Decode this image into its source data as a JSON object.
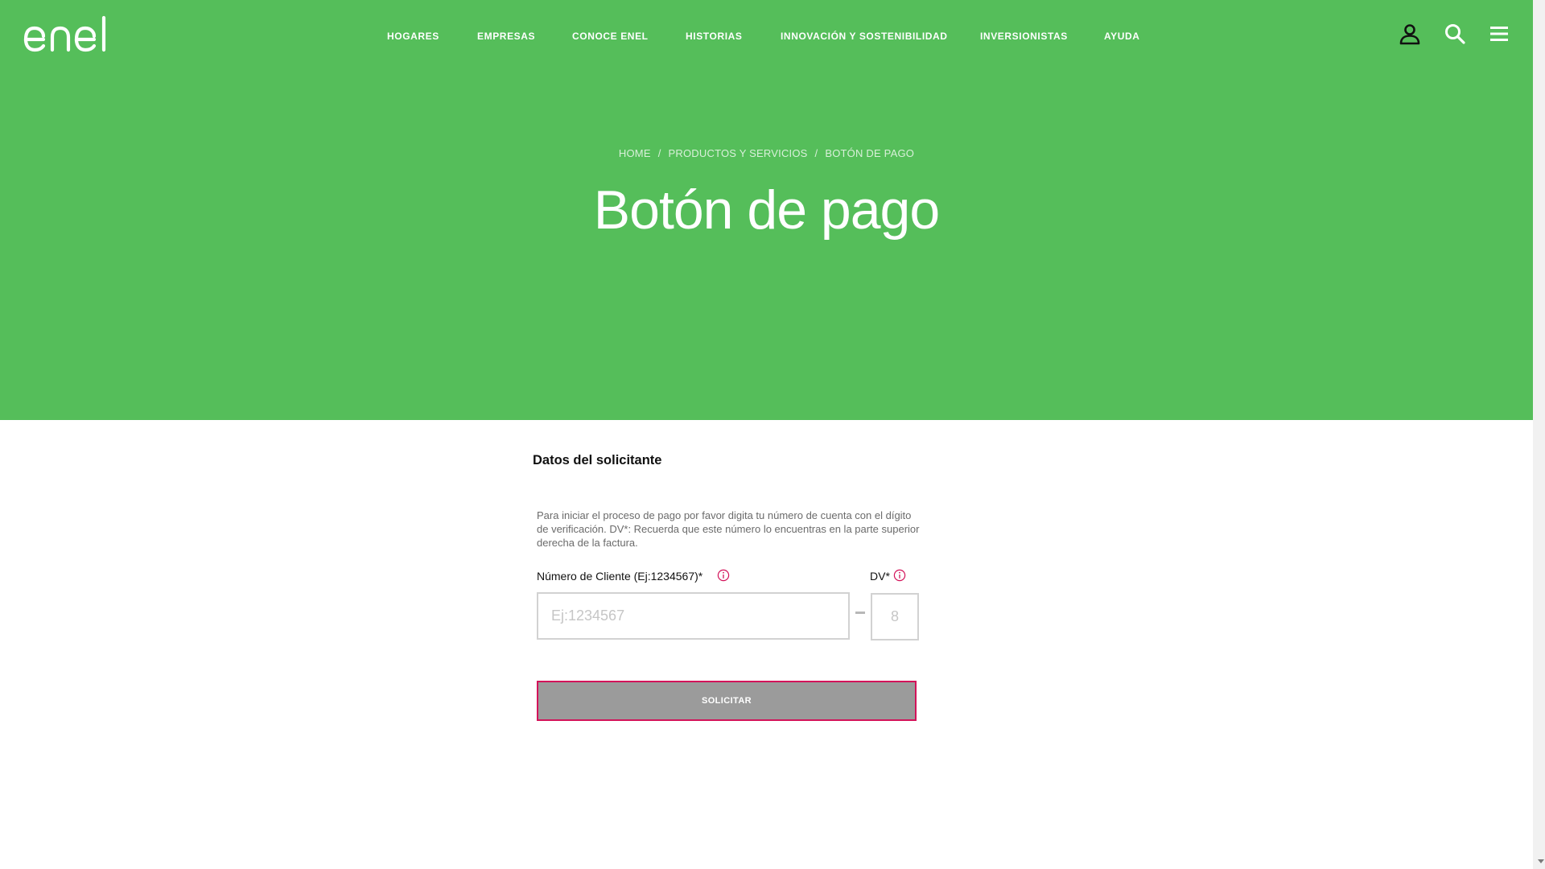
{
  "brand": {
    "logo_text": "enel",
    "colors": {
      "primary": "#55be5a",
      "accent": "#d3135a",
      "button_bg": "#9b9b9b"
    }
  },
  "nav": {
    "items": [
      {
        "label": "HOGARES"
      },
      {
        "label": "EMPRESAS"
      },
      {
        "label": "CONOCE ENEL"
      },
      {
        "label": "HISTORIAS"
      },
      {
        "label": "INNOVACIÓN Y SOSTENIBILIDAD"
      },
      {
        "label": "INVERSIONISTAS"
      },
      {
        "label": "AYUDA"
      }
    ],
    "icons": [
      "user-icon",
      "search-icon",
      "menu-icon"
    ]
  },
  "breadcrumb": {
    "items": [
      "HOME",
      "PRODUCTOS Y SERVICIOS",
      "BOTÓN DE PAGO"
    ],
    "separator": "/"
  },
  "page_title": "Botón de pago",
  "form": {
    "section_title": "Datos del solicitante",
    "intro": "Para iniciar el proceso de pago por favor digita tu número de cuenta con el dígito de verificación. DV*: Recuerda que este número lo encuentras en la parte superior derecha de la factura.",
    "client_label": "Número de Cliente (Ej:1234567)*",
    "client_placeholder": "Ej:1234567",
    "client_value": "",
    "dv_label": "DV*",
    "dv_placeholder": "8",
    "dv_value": "",
    "submit_label": "SOLICITAR"
  }
}
